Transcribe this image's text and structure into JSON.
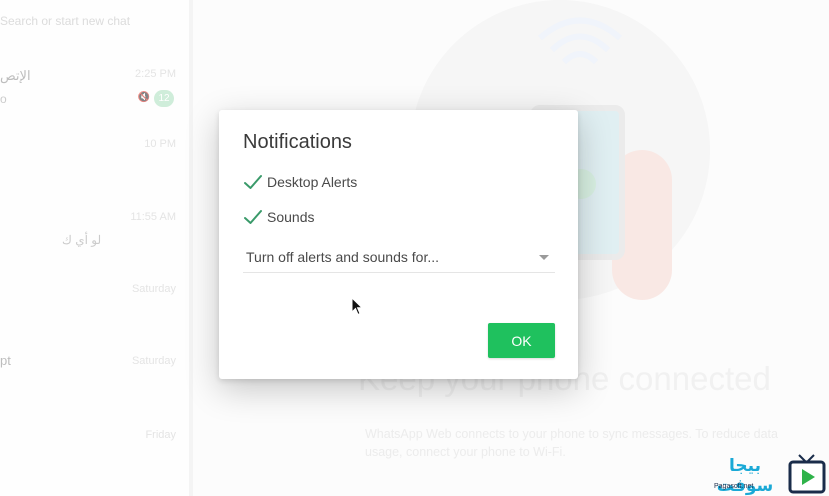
{
  "background": {
    "list_header": "Search or start new chat",
    "chats": [
      {
        "name": "الإتص",
        "time": "2:25 PM",
        "preview": "o",
        "unread": "12"
      },
      {
        "name": "",
        "time": "10 PM",
        "preview": ""
      },
      {
        "name": "",
        "time": "11:55 AM",
        "preview": "لو أي ك"
      },
      {
        "name": "",
        "time": "Saturday",
        "preview": ""
      },
      {
        "name": "pt",
        "time": "Saturday",
        "preview": ""
      },
      {
        "name": "",
        "time": "Friday",
        "preview": ""
      }
    ],
    "headline": "Keep your phone connected",
    "subline": "WhatsApp Web connects to your phone to sync messages. To reduce data usage, connect your phone to Wi-Fi."
  },
  "dialog": {
    "title": "Notifications",
    "options": [
      {
        "label": "Desktop Alerts",
        "checked": true
      },
      {
        "label": "Sounds",
        "checked": true
      }
    ],
    "select_value": "Turn off alerts and sounds for...",
    "ok_label": "OK"
  },
  "watermark": {
    "brand": "بيجا سوفت",
    "site": "Pagasoft.net"
  },
  "colors": {
    "accent_green": "#1fc15e",
    "check_green": "#3a9a6a"
  }
}
